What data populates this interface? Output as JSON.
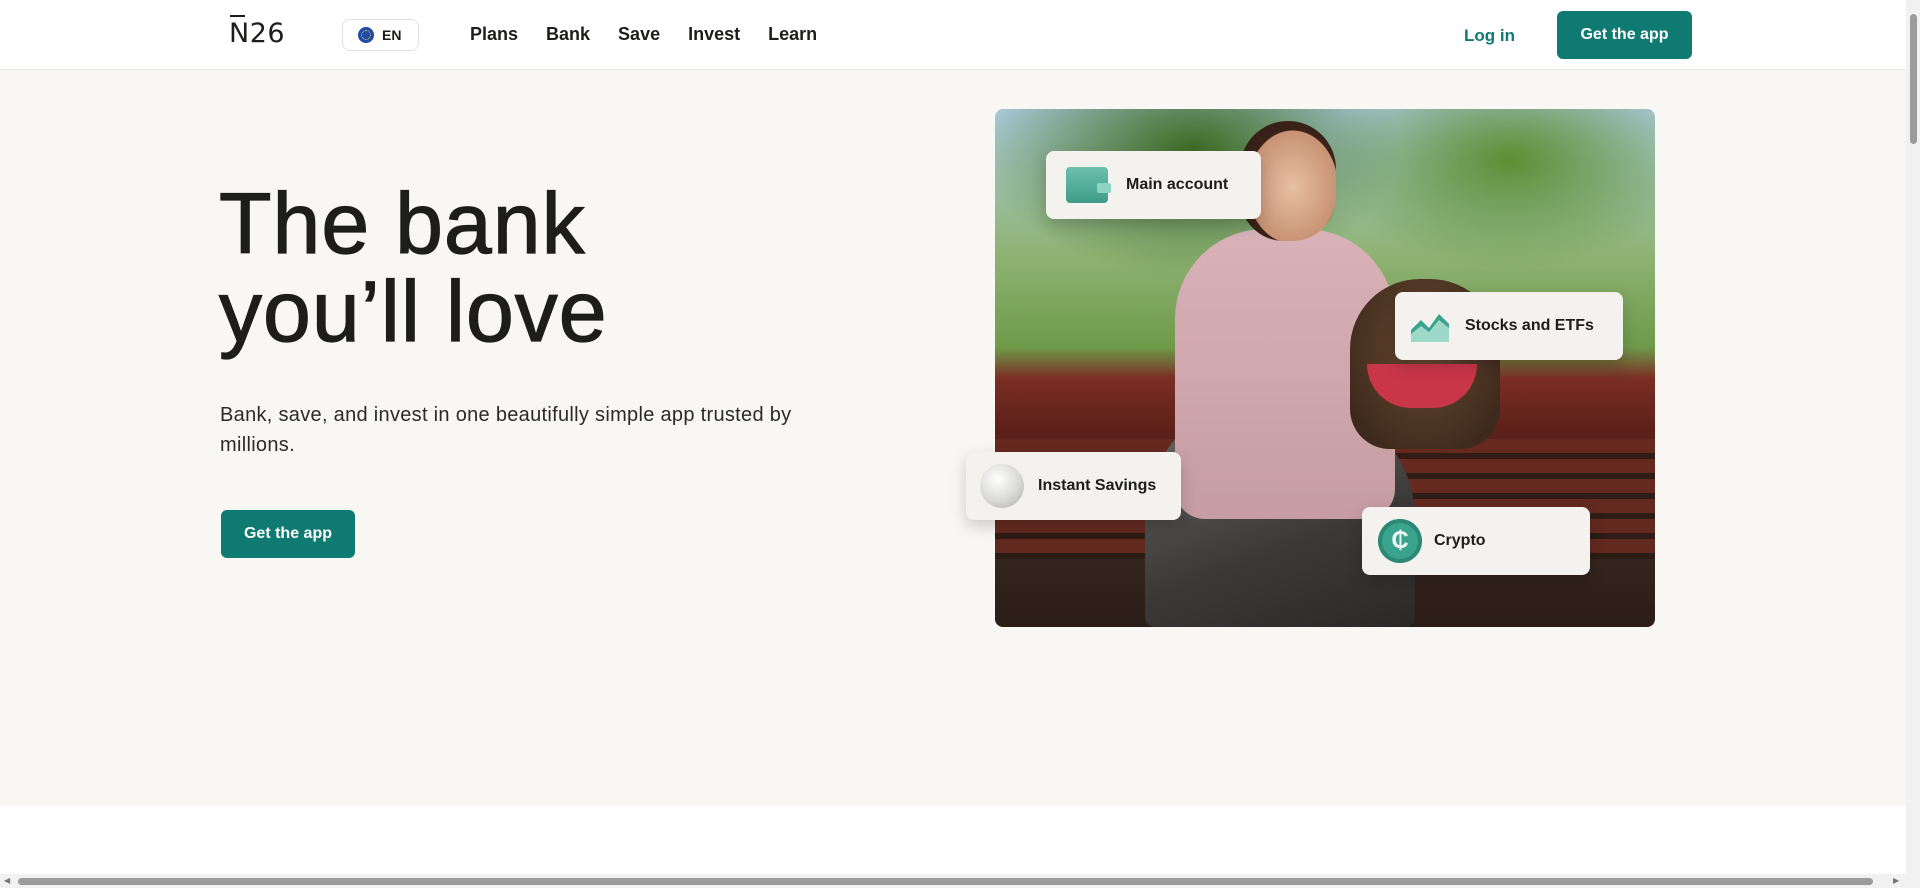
{
  "header": {
    "logo": "N26",
    "language": "EN",
    "nav": [
      "Plans",
      "Bank",
      "Save",
      "Invest",
      "Learn"
    ],
    "login": "Log in",
    "cta": "Get the app"
  },
  "hero": {
    "headline_line1": "The bank",
    "headline_line2": "you’ll love",
    "subtitle": "Bank, save, and invest in one beautifully simple app trusted by millions.",
    "cta": "Get the app"
  },
  "cards": {
    "main_account": "Main account",
    "stocks": "Stocks and ETFs",
    "savings": "Instant Savings",
    "crypto": "Crypto"
  },
  "icons": {
    "language": "eu-flag-icon",
    "main_account": "wallet-icon",
    "stocks": "chart-icon",
    "savings": "piggy-bank-icon",
    "crypto": "crypto-coin-icon"
  },
  "colors": {
    "brand": "#0f7a72",
    "hero_bg": "#f8f7f4"
  }
}
